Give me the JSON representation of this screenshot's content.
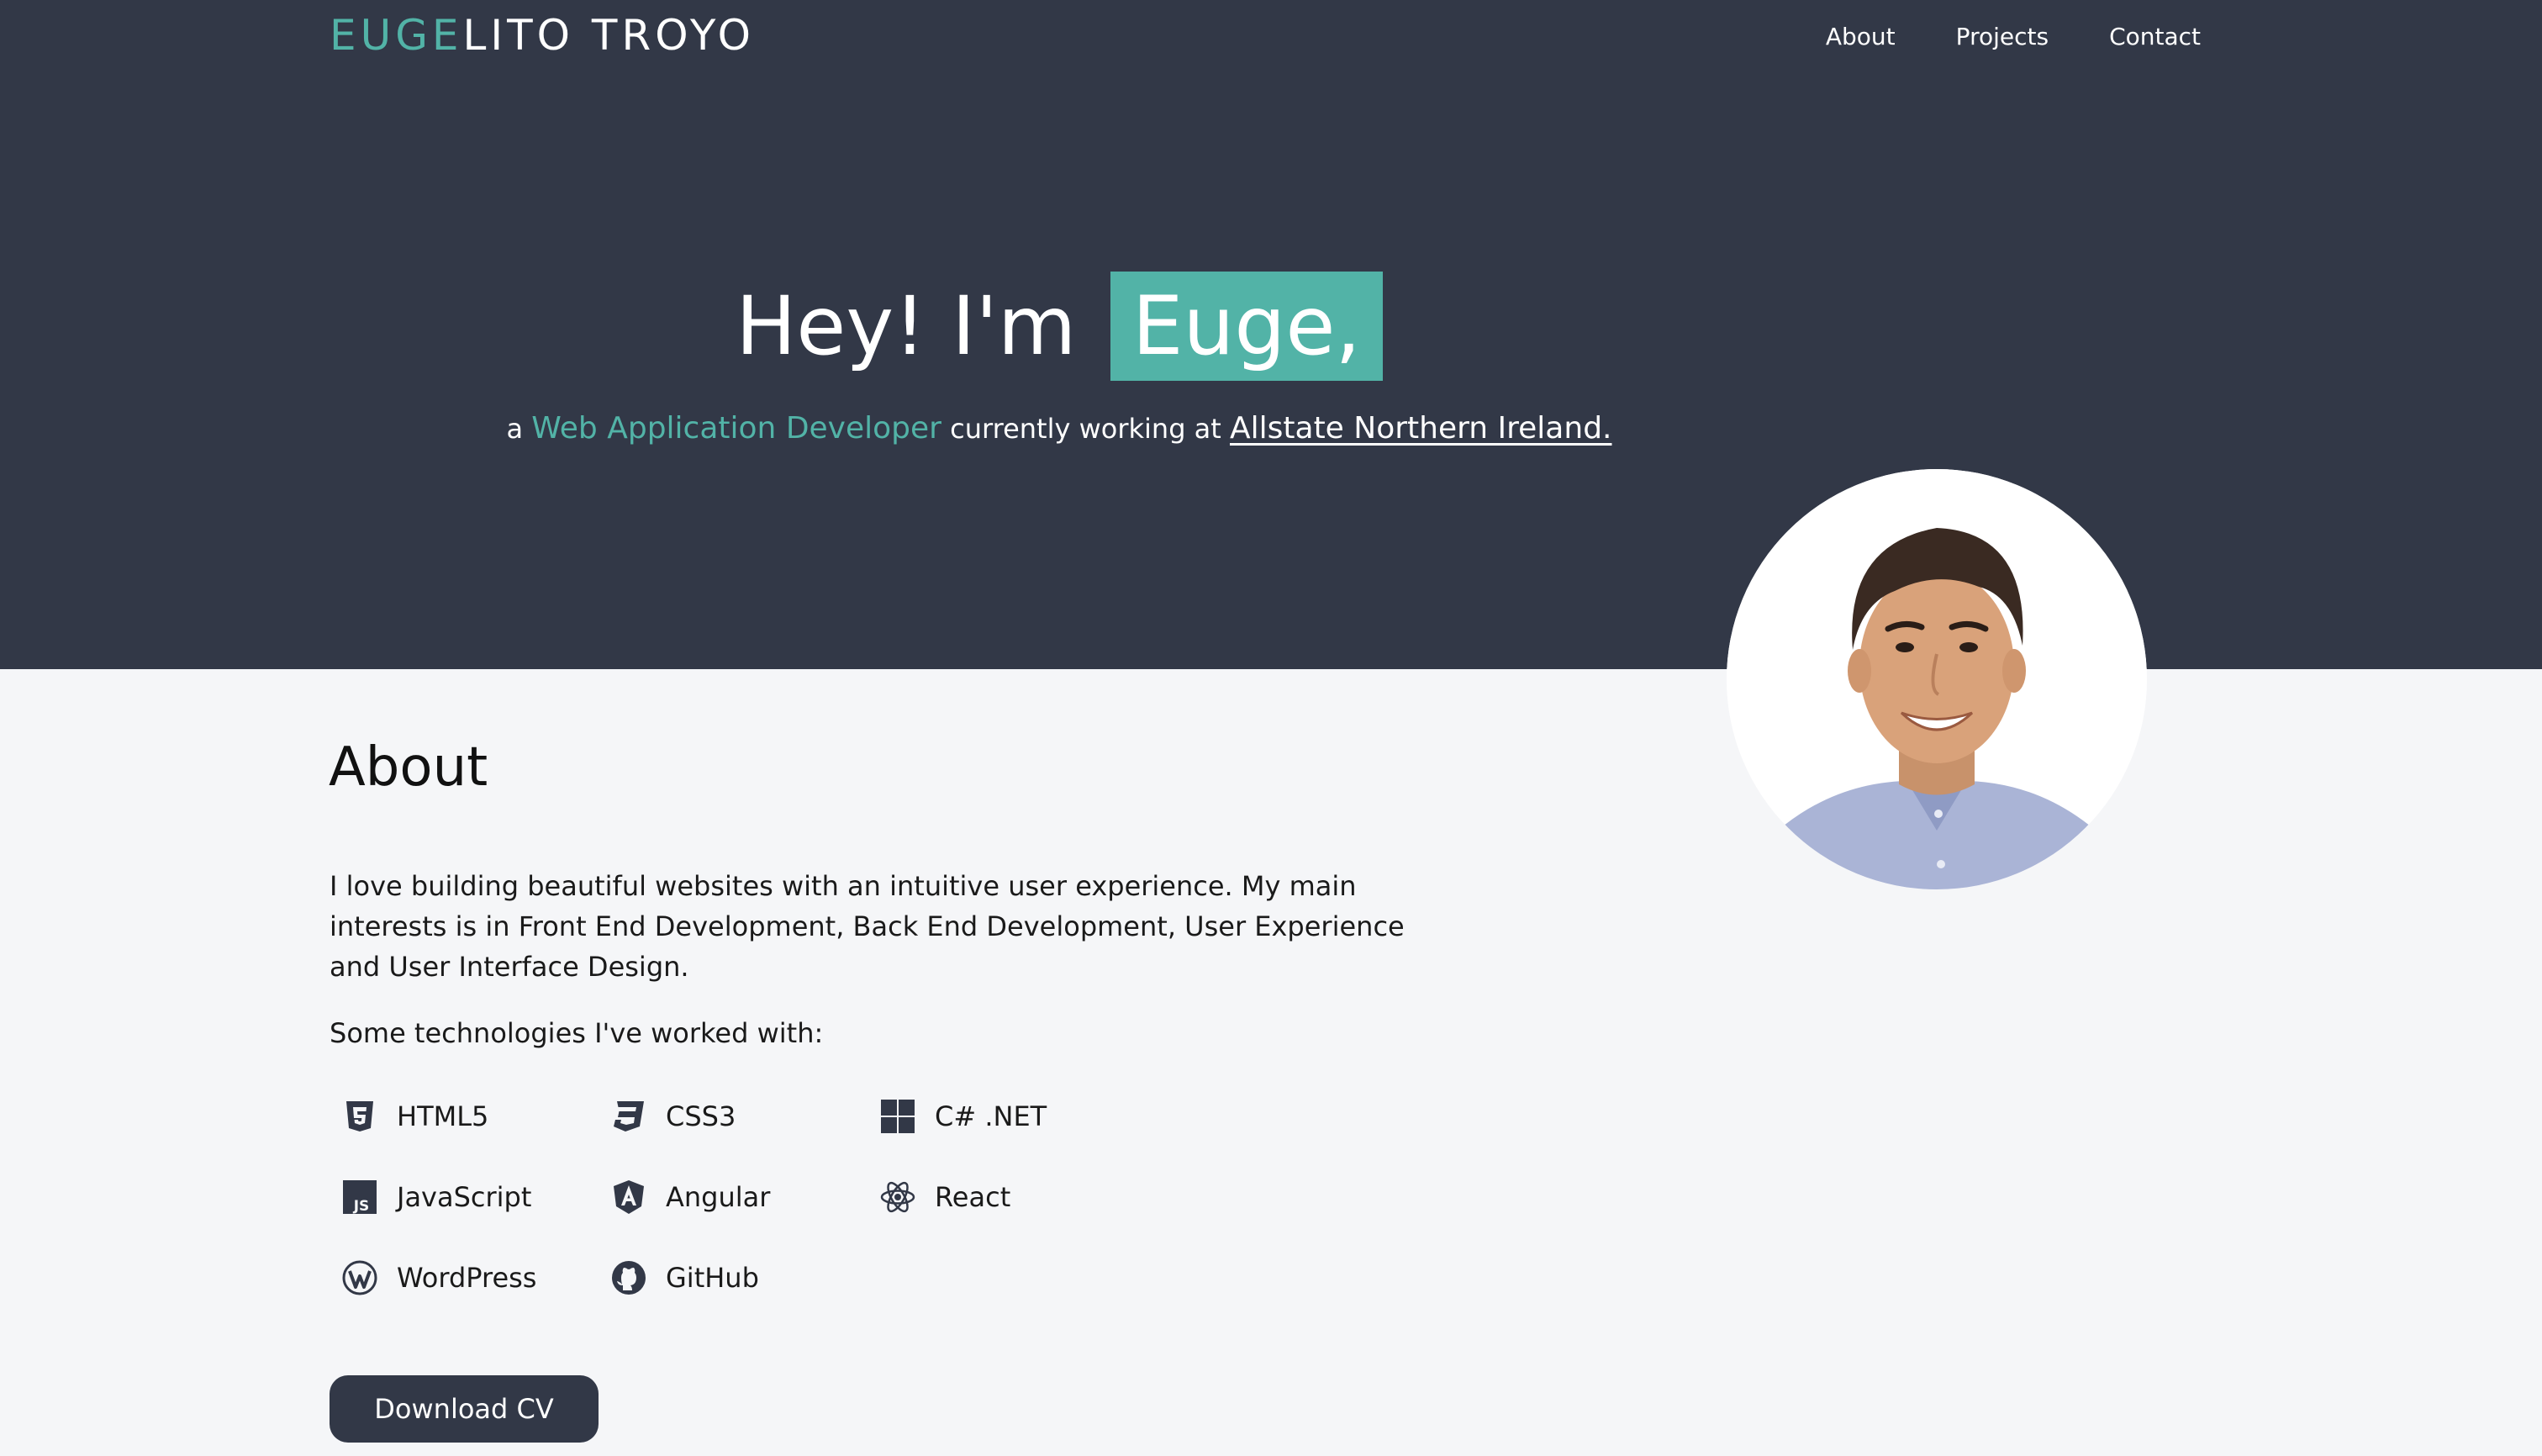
{
  "brand": {
    "accent_part": "EUGE",
    "rest_part": "LITO TROYO"
  },
  "nav": {
    "items": [
      {
        "label": "About"
      },
      {
        "label": "Projects"
      },
      {
        "label": "Contact"
      }
    ]
  },
  "hero": {
    "greeting": "Hey! I'm",
    "name": "Euge,",
    "sub_prefix": "a",
    "role": "Web Application Developer",
    "sub_middle": "currently working at",
    "company": "Allstate Northern Ireland."
  },
  "about": {
    "title": "About",
    "paragraph": "I love building beautiful websites with an intuitive user experience. My main interests is in Front End Development, Back End Development, User Experience and User Interface Design.",
    "tech_intro": "Some technologies I've worked with:",
    "technologies": [
      {
        "label": "HTML5",
        "icon": "html5-icon"
      },
      {
        "label": "CSS3",
        "icon": "css3-icon"
      },
      {
        "label": "C# .NET",
        "icon": "windows-icon"
      },
      {
        "label": "JavaScript",
        "icon": "javascript-icon"
      },
      {
        "label": "Angular",
        "icon": "angular-icon"
      },
      {
        "label": "React",
        "icon": "react-icon"
      },
      {
        "label": "WordPress",
        "icon": "wordpress-icon"
      },
      {
        "label": "GitHub",
        "icon": "github-icon"
      }
    ],
    "cv_button": "Download CV"
  },
  "colors": {
    "dark": "#323847",
    "accent": "#52b3a7",
    "background": "#f5f6f8"
  }
}
